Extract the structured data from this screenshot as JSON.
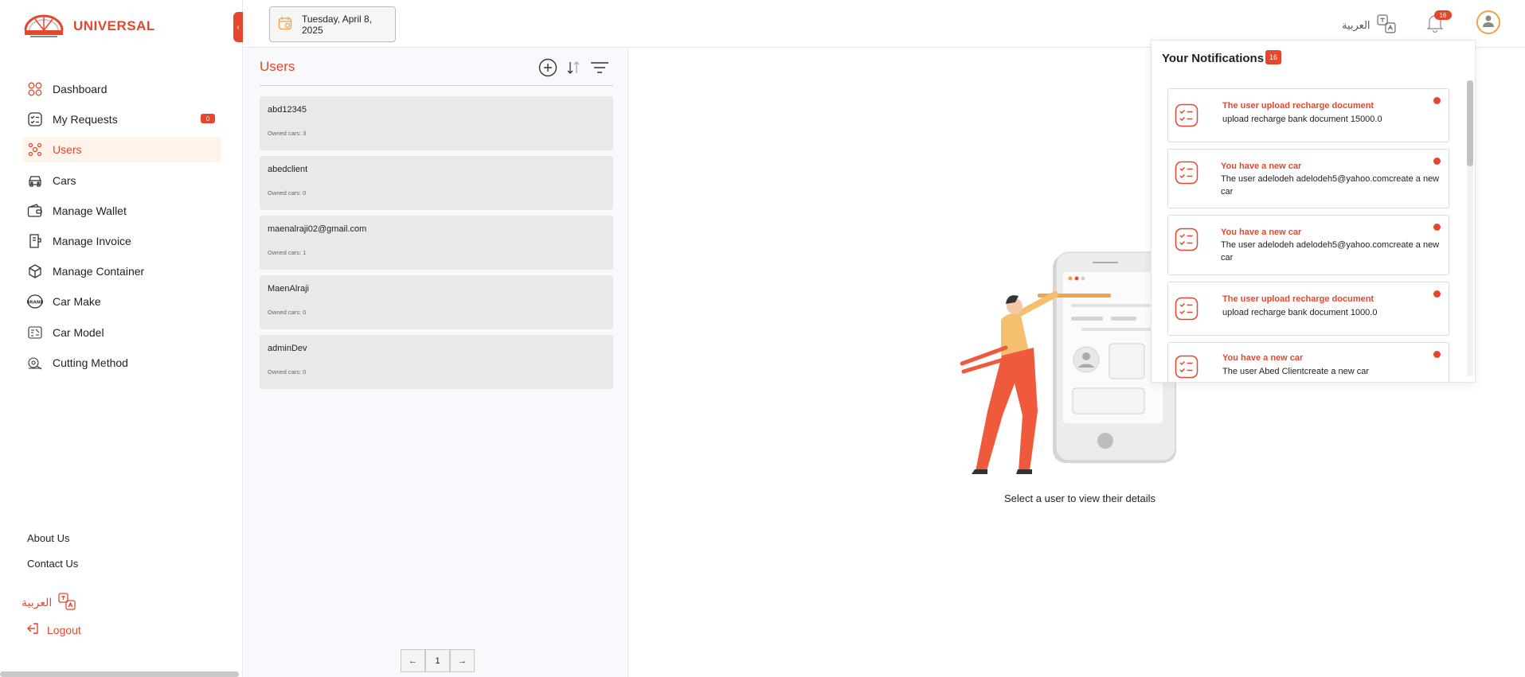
{
  "brand": {
    "name": "UNIVERSAL",
    "accent": "#e4472d"
  },
  "topbar": {
    "date": "Tuesday, April 8, 2025",
    "language": "العربية",
    "notification_count": "16"
  },
  "sidebar": {
    "items": [
      {
        "label": "Dashboard",
        "icon": "dashboard-icon"
      },
      {
        "label": "My Requests",
        "icon": "requests-icon",
        "badge": "0"
      },
      {
        "label": "Users",
        "icon": "users-icon",
        "active": true
      },
      {
        "label": "Cars",
        "icon": "car-icon"
      },
      {
        "label": "Manage Wallet",
        "icon": "wallet-icon"
      },
      {
        "label": "Manage Invoice",
        "icon": "invoice-icon"
      },
      {
        "label": "Manage Container",
        "icon": "container-icon"
      },
      {
        "label": "Car Make",
        "icon": "brand-icon"
      },
      {
        "label": "Car Model",
        "icon": "car-model-icon"
      },
      {
        "label": "Cutting Method",
        "icon": "cutting-icon"
      }
    ],
    "about": "About Us",
    "contact": "Contact Us",
    "language": "العربية",
    "logout": "Logout"
  },
  "users": {
    "title": "Users",
    "list": [
      {
        "name": "abd12345",
        "cars": "Owned cars: 3"
      },
      {
        "name": "abedclient",
        "cars": "Owned cars: 0"
      },
      {
        "name": "maenalraji02@gmail.com",
        "cars": "Owned cars: 1"
      },
      {
        "name": "MaenAlraji",
        "cars": "Owned cars: 0"
      },
      {
        "name": "adminDev",
        "cars": "Owned cars: 0"
      }
    ],
    "page": "1"
  },
  "details": {
    "empty_message": "Select a user to view their details"
  },
  "notifications": {
    "title": "Your Notifications",
    "count": "16",
    "items": [
      {
        "title": "The user upload recharge document",
        "body": "upload recharge bank document 15000.0"
      },
      {
        "title": "You have a new car",
        "body": "The user adelodeh adelodeh5@yahoo.comcreate a new car"
      },
      {
        "title": "You have a new car",
        "body": "The user adelodeh adelodeh5@yahoo.comcreate a new car"
      },
      {
        "title": "The user upload recharge document",
        "body": "upload recharge bank document 1000.0"
      },
      {
        "title": "You have a new car",
        "body": "The user Abed Clientcreate a new car"
      }
    ]
  }
}
